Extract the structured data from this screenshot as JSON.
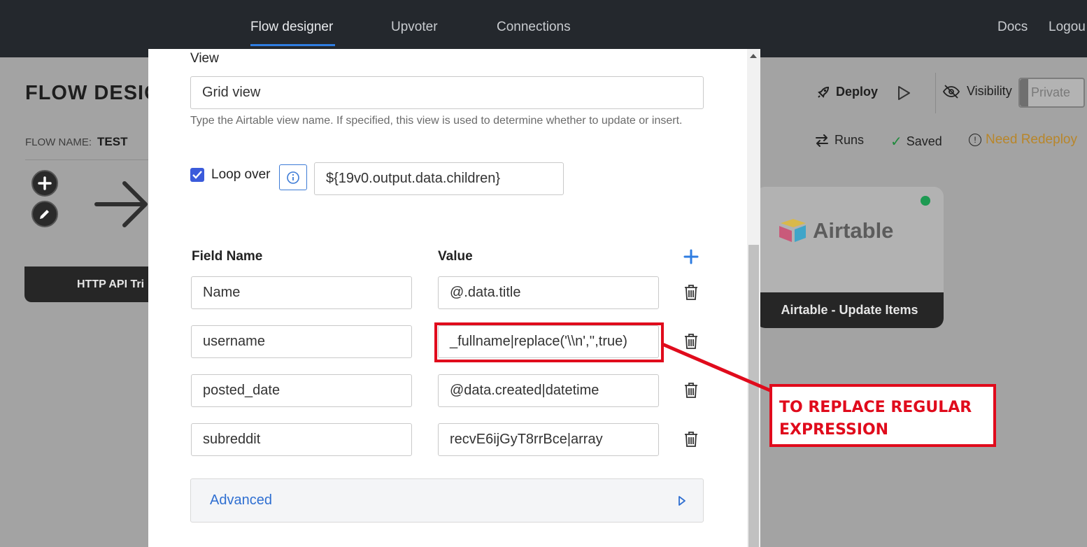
{
  "nav": {
    "items": [
      "Flow designer",
      "Upvoter",
      "Connections"
    ],
    "docs": "Docs",
    "logout": "Logou"
  },
  "page": {
    "title": "FLOW DESIG",
    "flow_name_label": "FLOW NAME:",
    "flow_name_value": "TEST",
    "deploy": "Deploy",
    "visibility": "Visibility",
    "privacy": "Private",
    "runs": "Runs",
    "saved": "Saved",
    "need_redeploy": "Need Redeploy",
    "http_node": "HTTP API Tri",
    "airtable_logo": "Airtable",
    "airtable_node": "Airtable - Update Items"
  },
  "modal": {
    "view_label": "View",
    "view_value": "Grid view",
    "view_help": "Type the Airtable view name. If specified, this view is used to determine whether to update or insert.",
    "loop_label": "Loop over",
    "loop_checked": true,
    "loop_value": "${19v0.output.data.children}",
    "col_field": "Field Name",
    "col_value": "Value",
    "rows": [
      {
        "field": "Name",
        "value": "@.data.title"
      },
      {
        "field": "username",
        "value": "_fullname|replace('\\\\n','',true)"
      },
      {
        "field": "posted_date",
        "value": "@data.created|datetime"
      },
      {
        "field": "subreddit",
        "value": "recvE6ijGyT8rrBce|array"
      }
    ],
    "advanced": "Advanced"
  },
  "annotation": {
    "line1": "TO REPLACE REGULAR",
    "line2": "EXPRESSION",
    "color": "#e00b1c"
  },
  "colors": {
    "nav_bg": "#24282d",
    "accent": "#2f7de1",
    "checkbox": "#3b5bdb",
    "warning": "#b8862a",
    "status_ok": "#1d9a52"
  }
}
